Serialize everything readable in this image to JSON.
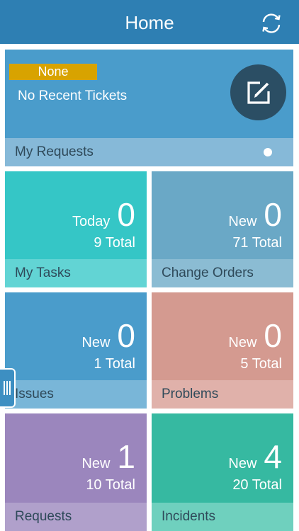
{
  "header": {
    "title": "Home"
  },
  "summary": {
    "badge": "None",
    "message": "No Recent Tickets",
    "footer": "My Requests"
  },
  "tiles": [
    {
      "label": "Today",
      "count": "0",
      "total": "9 Total",
      "footer": "My Tasks",
      "color": "#35c6c6",
      "footer_color": "#62d4d4"
    },
    {
      "label": "New",
      "count": "0",
      "total": "71 Total",
      "footer": "Change Orders",
      "color": "#6aa8c6",
      "footer_color": "#8bbcd3"
    },
    {
      "label": "New",
      "count": "0",
      "total": "1 Total",
      "footer": "Issues",
      "color": "#4a9ccb",
      "footer_color": "#79b6d8"
    },
    {
      "label": "New",
      "count": "0",
      "total": "5 Total",
      "footer": "Problems",
      "color": "#d49a90",
      "footer_color": "#e0b1aa"
    },
    {
      "label": "New",
      "count": "1",
      "total": "10 Total",
      "footer": "Requests",
      "color": "#9b86bd",
      "footer_color": "#b0a0cb"
    },
    {
      "label": "New",
      "count": "4",
      "total": "20 Total",
      "footer": "Incidents",
      "color": "#36b9a1",
      "footer_color": "#6fd0be"
    }
  ],
  "icons": {
    "sync": "sync-icon",
    "compose": "compose-icon",
    "drawer": "drawer-handle-icon"
  }
}
